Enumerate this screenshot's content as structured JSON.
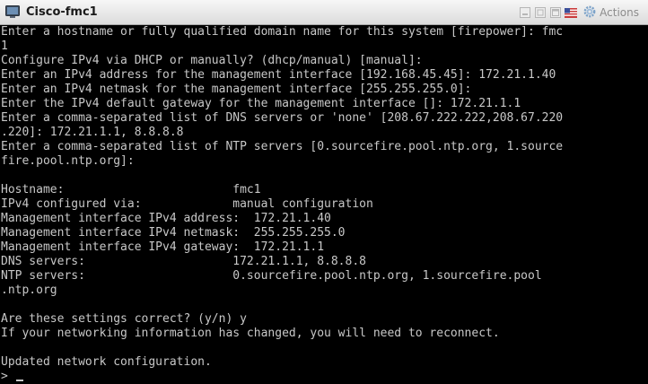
{
  "window": {
    "title": "Cisco-fmc1",
    "actions_label": "Actions"
  },
  "terminal": {
    "lines": [
      "Enter a hostname or fully qualified domain name for this system [firepower]: fmc",
      "1",
      "Configure IPv4 via DHCP or manually? (dhcp/manual) [manual]:",
      "Enter an IPv4 address for the management interface [192.168.45.45]: 172.21.1.40",
      "Enter an IPv4 netmask for the management interface [255.255.255.0]:",
      "Enter the IPv4 default gateway for the management interface []: 172.21.1.1",
      "Enter a comma-separated list of DNS servers or 'none' [208.67.222.222,208.67.220",
      ".220]: 172.21.1.1, 8.8.8.8",
      "Enter a comma-separated list of NTP servers [0.sourcefire.pool.ntp.org, 1.source",
      "fire.pool.ntp.org]:",
      "",
      "Hostname:                        fmc1",
      "IPv4 configured via:             manual configuration",
      "Management interface IPv4 address:  172.21.1.40",
      "Management interface IPv4 netmask:  255.255.255.0",
      "Management interface IPv4 gateway:  172.21.1.1",
      "DNS servers:                     172.21.1.1, 8.8.8.8",
      "NTP servers:                     0.sourcefire.pool.ntp.org, 1.sourcefire.pool",
      ".ntp.org",
      "",
      "Are these settings correct? (y/n) y",
      "If your networking information has changed, you will need to reconnect.",
      "",
      "Updated network configuration.",
      ">"
    ]
  },
  "colors": {
    "terminal_bg": "#000000",
    "terminal_fg": "#c8c8c8",
    "titlebar_top": "#f7f7f7",
    "titlebar_bottom": "#dcdcdc"
  }
}
